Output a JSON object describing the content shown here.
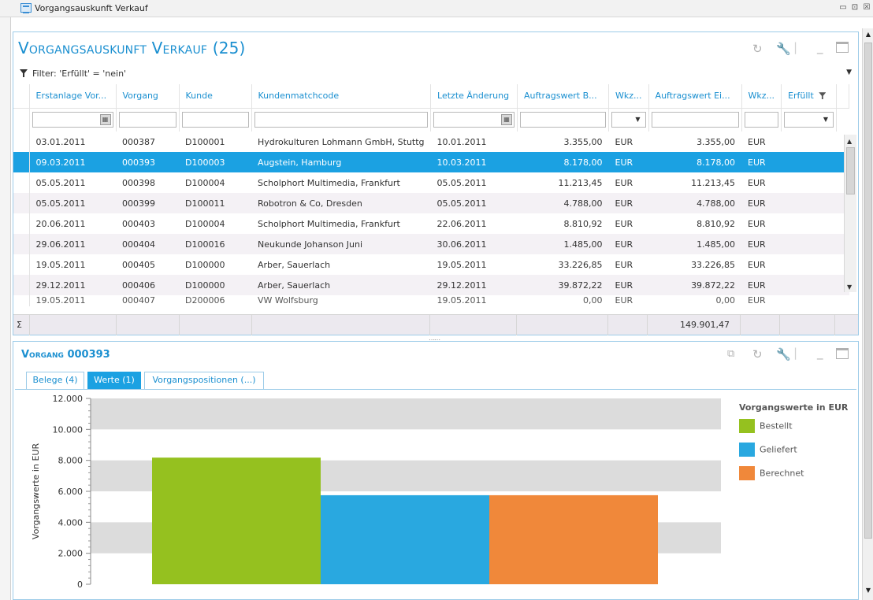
{
  "window": {
    "title": "Vorgangsauskunft Verkauf",
    "controls": [
      "▭",
      "⊡",
      "☒"
    ]
  },
  "list_panel": {
    "title": "Vorgangsauskunft Verkauf (25)",
    "filter_text": "Filter: 'Erfüllt' = 'nein'",
    "columns": [
      "Erstanlage Vor...",
      "Vorgang",
      "Kunde",
      "Kundenmatchcode",
      "Letzte Änderung",
      "Auftragswert B...",
      "Wkz...",
      "Auftragswert Ei...",
      "Wkz...",
      "Erfüllt"
    ],
    "rows": [
      [
        "03.01.2011",
        "000387",
        "D100001",
        "Hydrokulturen Lohmann GmbH, Stuttg",
        "10.01.2011",
        "3.355,00",
        "EUR",
        "3.355,00",
        "EUR",
        ""
      ],
      [
        "09.03.2011",
        "000393",
        "D100003",
        "Augstein, Hamburg",
        "10.03.2011",
        "8.178,00",
        "EUR",
        "8.178,00",
        "EUR",
        ""
      ],
      [
        "05.05.2011",
        "000398",
        "D100004",
        "Scholphort Multimedia, Frankfurt",
        "05.05.2011",
        "11.213,45",
        "EUR",
        "11.213,45",
        "EUR",
        ""
      ],
      [
        "05.05.2011",
        "000399",
        "D100011",
        "Robotron & Co, Dresden",
        "05.05.2011",
        "4.788,00",
        "EUR",
        "4.788,00",
        "EUR",
        ""
      ],
      [
        "20.06.2011",
        "000403",
        "D100004",
        "Scholphort Multimedia, Frankfurt",
        "22.06.2011",
        "8.810,92",
        "EUR",
        "8.810,92",
        "EUR",
        ""
      ],
      [
        "29.06.2011",
        "000404",
        "D100016",
        "Neukunde Johanson Juni",
        "30.06.2011",
        "1.485,00",
        "EUR",
        "1.485,00",
        "EUR",
        ""
      ],
      [
        "19.05.2011",
        "000405",
        "D100000",
        "Arber, Sauerlach",
        "19.05.2011",
        "33.226,85",
        "EUR",
        "33.226,85",
        "EUR",
        ""
      ],
      [
        "29.12.2011",
        "000406",
        "D100000",
        "Arber, Sauerlach",
        "29.12.2011",
        "39.872,22",
        "EUR",
        "39.872,22",
        "EUR",
        ""
      ],
      [
        "19.05.2011",
        "000407",
        "D200006",
        "VW Wolfsburg",
        "19.05.2011",
        "0,00",
        "EUR",
        "0,00",
        "EUR",
        ""
      ]
    ],
    "selected_row": 1,
    "sum_symbol": "Σ",
    "sum_value": "149.901,47"
  },
  "detail_panel": {
    "title": "Vorgang 000393",
    "tabs": [
      "Belege (4)",
      "Werte (1)",
      "Vorgangspositionen (...)"
    ],
    "active_tab": 1
  },
  "chart_data": {
    "type": "bar",
    "title": "",
    "ylabel": "Vorgangswerte in EUR",
    "xlabel": "",
    "ylim": [
      0,
      12000
    ],
    "yticks": [
      "0",
      "2.000",
      "4.000",
      "6.000",
      "8.000",
      "10.000",
      "12.000"
    ],
    "legend_title": "Vorgangswerte in EUR",
    "legend_position": "right",
    "series": [
      {
        "name": "Bestellt",
        "value": 8178,
        "color": "#95c11f"
      },
      {
        "name": "Geliefert",
        "value": 5750,
        "color": "#29a8e0"
      },
      {
        "name": "Berechnet",
        "value": 5750,
        "color": "#f0883a"
      }
    ]
  }
}
